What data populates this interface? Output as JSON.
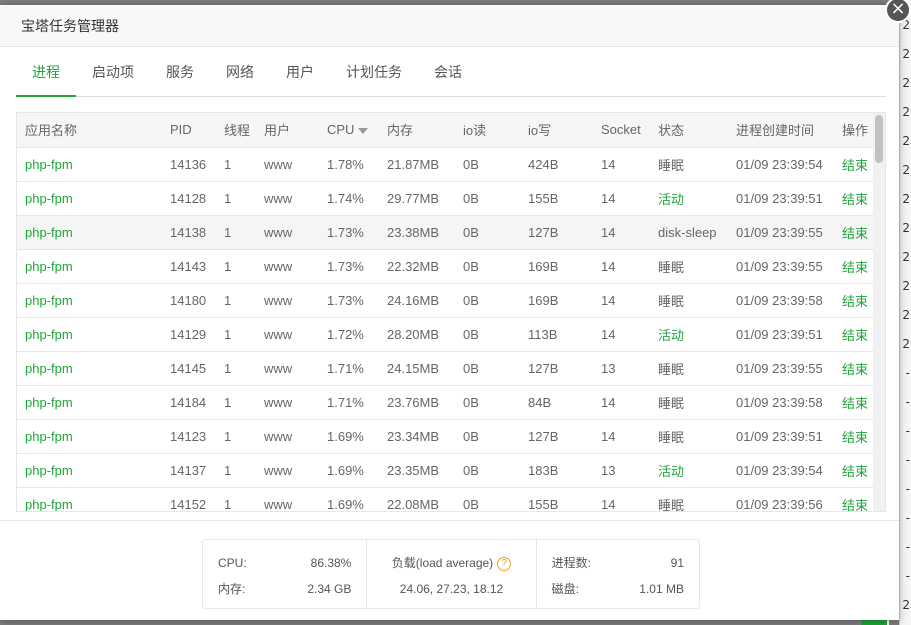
{
  "dialog": {
    "title": "宝塔任务管理器",
    "close_label": "×"
  },
  "tabs": [
    "进程",
    "启动项",
    "服务",
    "网络",
    "用户",
    "计划任务",
    "会话"
  ],
  "table": {
    "columns": [
      "应用名称",
      "PID",
      "线程",
      "用户",
      "CPU",
      "内存",
      "io读",
      "io写",
      "Socket",
      "状态",
      "进程创建时间",
      "操作"
    ],
    "rows": [
      [
        "php-fpm",
        "14136",
        "1",
        "www",
        "1.78%",
        "21.87MB",
        "0B",
        "424B",
        "14",
        "睡眠",
        "01/09 23:39:54",
        "结束"
      ],
      [
        "php-fpm",
        "14128",
        "1",
        "www",
        "1.74%",
        "29.77MB",
        "0B",
        "155B",
        "14",
        "活动",
        "01/09 23:39:51",
        "结束"
      ],
      [
        "php-fpm",
        "14138",
        "1",
        "www",
        "1.73%",
        "23.38MB",
        "0B",
        "127B",
        "14",
        "disk-sleep",
        "01/09 23:39:55",
        "结束"
      ],
      [
        "php-fpm",
        "14143",
        "1",
        "www",
        "1.73%",
        "22.32MB",
        "0B",
        "169B",
        "14",
        "睡眠",
        "01/09 23:39:55",
        "结束"
      ],
      [
        "php-fpm",
        "14180",
        "1",
        "www",
        "1.73%",
        "24.16MB",
        "0B",
        "169B",
        "14",
        "睡眠",
        "01/09 23:39:58",
        "结束"
      ],
      [
        "php-fpm",
        "14129",
        "1",
        "www",
        "1.72%",
        "28.20MB",
        "0B",
        "113B",
        "14",
        "活动",
        "01/09 23:39:51",
        "结束"
      ],
      [
        "php-fpm",
        "14145",
        "1",
        "www",
        "1.71%",
        "24.15MB",
        "0B",
        "127B",
        "13",
        "睡眠",
        "01/09 23:39:55",
        "结束"
      ],
      [
        "php-fpm",
        "14184",
        "1",
        "www",
        "1.71%",
        "23.76MB",
        "0B",
        "84B",
        "14",
        "睡眠",
        "01/09 23:39:58",
        "结束"
      ],
      [
        "php-fpm",
        "14123",
        "1",
        "www",
        "1.69%",
        "23.34MB",
        "0B",
        "127B",
        "14",
        "睡眠",
        "01/09 23:39:51",
        "结束"
      ],
      [
        "php-fpm",
        "14137",
        "1",
        "www",
        "1.69%",
        "23.35MB",
        "0B",
        "183B",
        "13",
        "活动",
        "01/09 23:39:54",
        "结束"
      ],
      [
        "php-fpm",
        "14152",
        "1",
        "www",
        "1.69%",
        "22.08MB",
        "0B",
        "155B",
        "14",
        "睡眠",
        "01/09 23:39:56",
        "结束"
      ]
    ]
  },
  "stats": {
    "cpu_label": "CPU:",
    "cpu_value": "86.38%",
    "mem_label": "内存:",
    "mem_value": "2.34 GB",
    "load_label": "负载(load average)",
    "load_value": "24.06, 27.23, 18.12",
    "proc_label": "进程数:",
    "proc_value": "91",
    "disk_label": "磁盘:",
    "disk_value": "1.01 MB"
  },
  "background": {
    "marks": [
      "2",
      "2",
      "2",
      "2",
      "2",
      "2",
      "2",
      "2",
      "2",
      "2",
      "2",
      "2",
      "-",
      "-",
      "-",
      "-",
      "-",
      "-",
      "-",
      "-",
      "2"
    ]
  },
  "colors": {
    "accent": "#20a53a",
    "help": "#f0a020"
  },
  "icons": {
    "close": "close-icon",
    "help": "question-circle-icon",
    "sort": "sort-desc-icon"
  }
}
